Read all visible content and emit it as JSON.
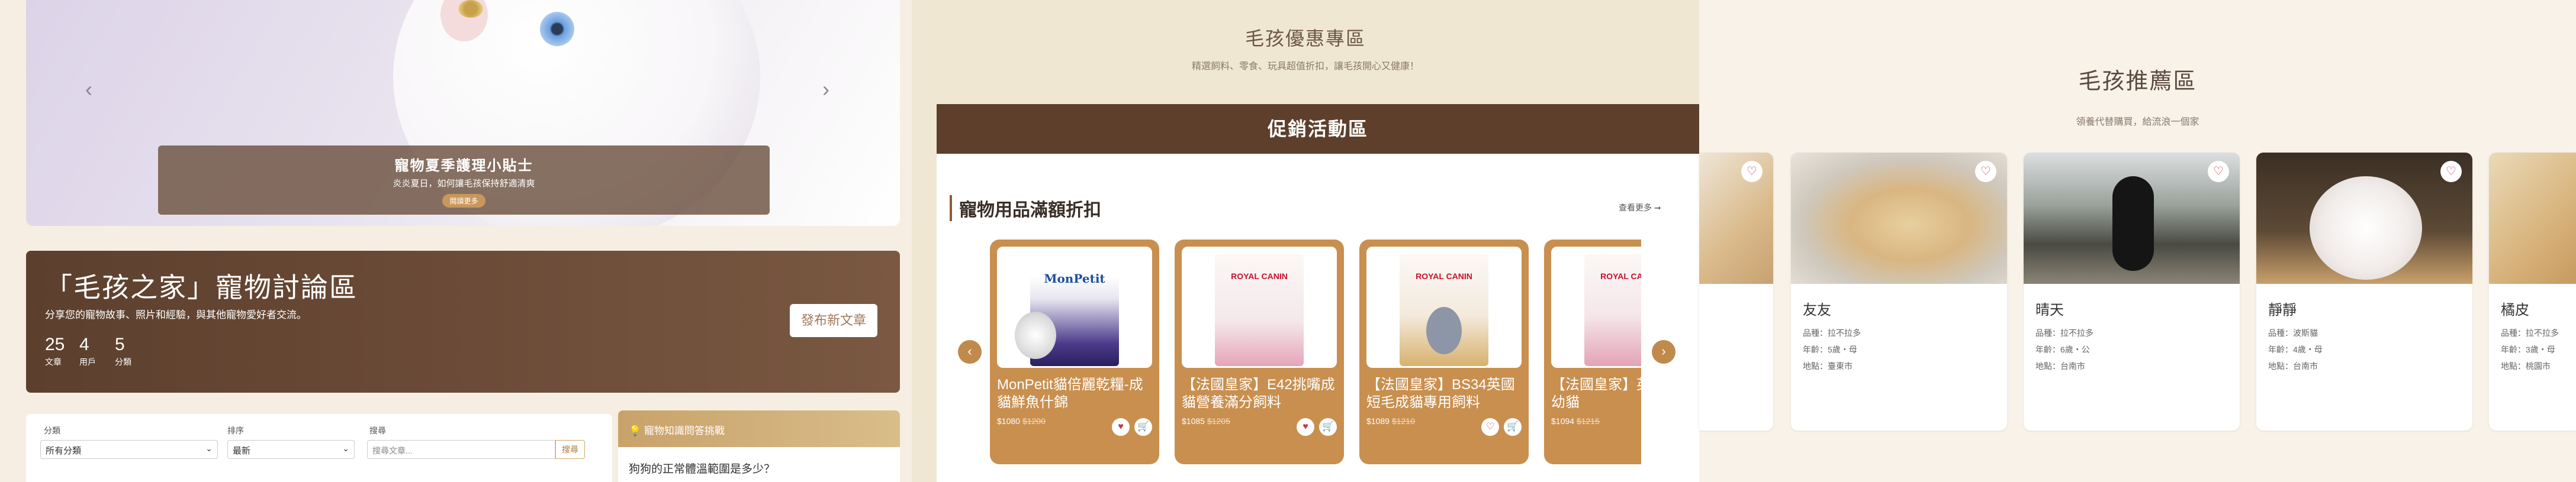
{
  "hero": {
    "caption_title": "寵物夏季護理小貼士",
    "caption_sub": "炎炎夏日，如何讓毛孩保持舒適清爽",
    "caption_button": "閱讀更多",
    "prev_arrow": "‹",
    "next_arrow": "›"
  },
  "forum": {
    "title": "「毛孩之家」寵物討論區",
    "desc": "分享您的寵物故事、照片和經驗，與其他寵物愛好者交流。",
    "stats": [
      {
        "num": "25",
        "label": "文章"
      },
      {
        "num": "4",
        "label": "用戶"
      },
      {
        "num": "5",
        "label": "分類"
      }
    ],
    "post_button": "發布新文章"
  },
  "filters": {
    "category_label": "分類",
    "category_value": "所有分類",
    "sort_label": "排序",
    "sort_value": "最新",
    "search_label": "搜尋",
    "search_placeholder": "搜尋文章...",
    "search_button": "搜尋"
  },
  "faq": {
    "header": "寵物知識問答挑戰",
    "question": "狗狗的正常體溫範圍是多少？"
  },
  "promo": {
    "title": "毛孩優惠專區",
    "subtitle": "精選飼料、零食、玩具超值折扣，讓毛孩開心又健康！",
    "header": "促銷活動區",
    "section_title": "寵物用品滿額折扣",
    "see_more": "查看更多 ➞",
    "products": [
      {
        "name": "MonPetit貓倍麗乾糧-成貓鮮魚什錦",
        "price": "$1080",
        "orig": "$1200",
        "fav": "♥",
        "cart": "🛒"
      },
      {
        "name": "【法國皇家】E42挑嘴成貓營養滿分飼料",
        "price": "$1085",
        "orig": "$1205",
        "fav": "♥",
        "cart": "🛒"
      },
      {
        "name": "【法國皇家】BS34英國短毛成貓專用飼料",
        "price": "$1089",
        "orig": "$1210",
        "fav": "♡",
        "cart": "🛒"
      },
      {
        "name": "【法國皇家】英國短毛幼貓",
        "price": "$1094",
        "orig": "$1215",
        "fav": "♥",
        "cart": "🛒"
      }
    ],
    "brand_monpetit": "MonPetit",
    "brand_royal": "ROYAL CANIN"
  },
  "recommend": {
    "title": "毛孩推薦區",
    "subtitle": "領養代替購買，給流浪一個家",
    "pets": [
      {
        "name": "友友",
        "breed": "品種：拉不拉多",
        "age": "年齡：5歲・母",
        "loc": "地點：臺東市",
        "heart": "♡"
      },
      {
        "name": "晴天",
        "breed": "品種：拉不拉多",
        "age": "年齡：6歲・公",
        "loc": "地點：台南市",
        "heart": "♡"
      },
      {
        "name": "靜靜",
        "breed": "品種：波斯貓",
        "age": "年齡：4歲・母",
        "loc": "地點：台南市",
        "heart": "♡"
      },
      {
        "name": "橘皮",
        "breed": "品種：拉不拉多",
        "age": "年齡：3歲・母",
        "loc": "地點：桃園市",
        "heart": "♡"
      }
    ],
    "partial_heart": "♡"
  }
}
